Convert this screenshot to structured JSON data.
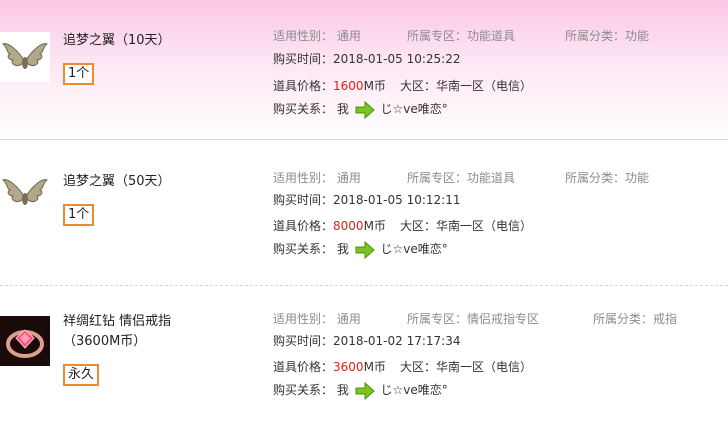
{
  "labels": {
    "gender": "适用性别：",
    "zone": "所属专区：",
    "category": "所属分类：",
    "time": "购买时间：",
    "price": "道具价格：",
    "region": "大区：",
    "relation": "购买关系："
  },
  "items": [
    {
      "name": "追梦之翼（10天）",
      "quantity": "1个",
      "gender": "通用",
      "zone": "功能道具",
      "category": "功能",
      "time": "2018-01-05 10:25:22",
      "price_value": "1600",
      "price_unit": "M币",
      "region": "华南一区（电信）",
      "buyer": "我",
      "receiver": "じ☆ve唯恋°",
      "icon": "wings-icon",
      "row_bg": "pink"
    },
    {
      "name": "追梦之翼（50天）",
      "quantity": "1个",
      "gender": "通用",
      "zone": "功能道具",
      "category": "功能",
      "time": "2018-01-05 10:12:11",
      "price_value": "8000",
      "price_unit": "M币",
      "region": "华南一区（电信）",
      "buyer": "我",
      "receiver": "じ☆ve唯恋°",
      "icon": "wings-icon",
      "row_bg": "white"
    },
    {
      "name_line1": "祥绸红钻 情侣戒指",
      "name_line2": "（3600M币）",
      "quantity": "永久",
      "gender": "通用",
      "zone": "情侣戒指专区",
      "category": "戒指",
      "time": "2018-01-02 17:17:34",
      "price_value": "3600",
      "price_unit": "M币",
      "region": "华南一区（电信）",
      "buyer": "我",
      "receiver": "じ☆ve唯恋°",
      "icon": "ring-icon",
      "row_bg": "white"
    }
  ],
  "colors": {
    "price": "#e0201b",
    "qty_border": "#f08a2c",
    "arrow": "#7cc520",
    "row_pink": "#fbc8e6"
  }
}
